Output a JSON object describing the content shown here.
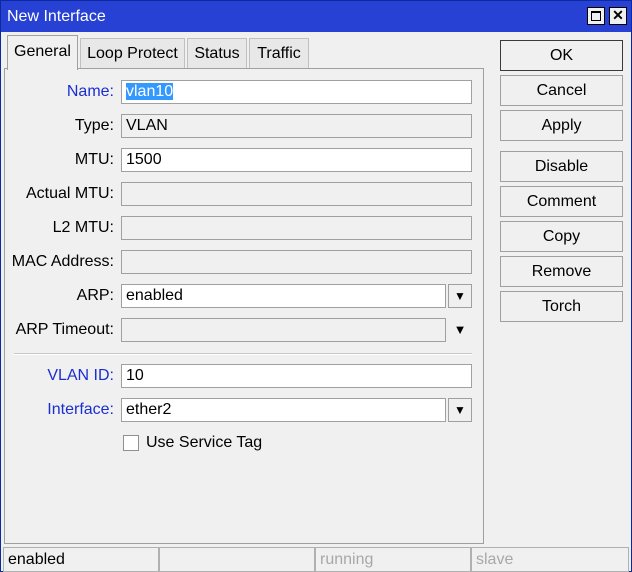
{
  "window": {
    "title": "New Interface"
  },
  "tabs": [
    "General",
    "Loop Protect",
    "Status",
    "Traffic"
  ],
  "form": {
    "name": {
      "label": "Name:",
      "value": "vlan10"
    },
    "type": {
      "label": "Type:",
      "value": "VLAN"
    },
    "mtu": {
      "label": "MTU:",
      "value": "1500"
    },
    "actual_mtu": {
      "label": "Actual MTU:",
      "value": ""
    },
    "l2_mtu": {
      "label": "L2 MTU:",
      "value": ""
    },
    "mac_address": {
      "label": "MAC Address:",
      "value": ""
    },
    "arp": {
      "label": "ARP:",
      "value": "enabled"
    },
    "arp_timeout": {
      "label": "ARP Timeout:",
      "value": ""
    },
    "vlan_id": {
      "label": "VLAN ID:",
      "value": "10"
    },
    "interface": {
      "label": "Interface:",
      "value": "ether2"
    },
    "service_tag": {
      "label": "Use Service Tag",
      "checked": false
    }
  },
  "buttons": {
    "ok": "OK",
    "cancel": "Cancel",
    "apply": "Apply",
    "disable": "Disable",
    "comment": "Comment",
    "copy": "Copy",
    "remove": "Remove",
    "torch": "Torch"
  },
  "statusbar": [
    "enabled",
    "",
    "running",
    "slave"
  ],
  "colors": {
    "titlebar": "#2641d4",
    "required_label": "#1a2ed0",
    "selection": "#3399ff"
  }
}
